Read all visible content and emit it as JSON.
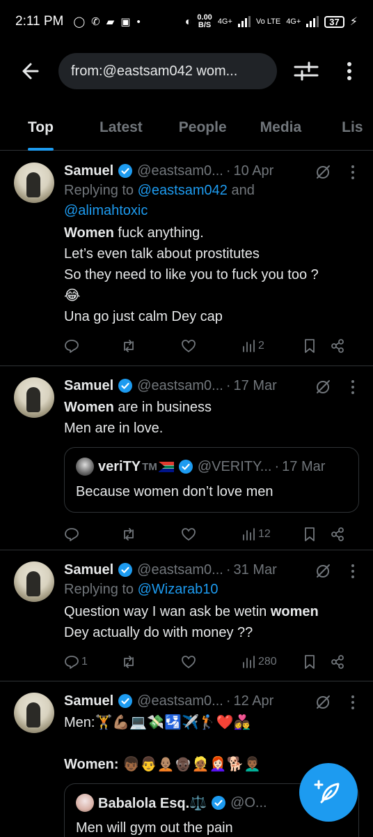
{
  "status_bar": {
    "time": "2:11 PM",
    "net_speed_value": "0.00",
    "net_speed_unit": "B/S",
    "net1": "4G+",
    "net2": "Vo LTE",
    "net3": "4G+",
    "battery": "37"
  },
  "search": {
    "query": "from:@eastsam042 wom..."
  },
  "tabs": [
    {
      "label": "Top",
      "active": true
    },
    {
      "label": "Latest",
      "active": false
    },
    {
      "label": "People",
      "active": false
    },
    {
      "label": "Media",
      "active": false
    },
    {
      "label": "Lis",
      "active": false
    }
  ],
  "tweets": [
    {
      "name": "Samuel",
      "handle": "@eastsam0...",
      "date": "10 Apr",
      "reply_prefix": "Replying to ",
      "reply_user1": "@eastsam042",
      "reply_and": " and",
      "reply_user2": "@alimahtoxic",
      "line1_bold": "Women",
      "line1_rest": " fuck anything.",
      "line2": "Let’s even talk about prostitutes",
      "line3": "So they need to like you to fuck you too ?",
      "line4": "😂",
      "line5": "Una go just calm Dey cap",
      "views": "2"
    },
    {
      "name": "Samuel",
      "handle": "@eastsam0...",
      "date": "17 Mar",
      "line1_bold": "Women",
      "line1_rest": " are in business",
      "line2": "Men are in love.",
      "quote": {
        "name": "veriTY",
        "tm": "TM",
        "handle": "@VERITY...",
        "date": "17 Mar",
        "text": "Because women don’t love men"
      },
      "views": "12"
    },
    {
      "name": "Samuel",
      "handle": "@eastsam0...",
      "date": "31 Mar",
      "reply_prefix": "Replying to ",
      "reply_user1": "@Wizarab10",
      "line1": "Question way I wan ask be wetin ",
      "line1_bold": "women",
      "line2": "Dey actually do with money ??",
      "replies": "1",
      "views": "280"
    },
    {
      "name": "Samuel",
      "handle": "@eastsam0...",
      "date": "12 Apr",
      "line1": "Men:🏋️💪🏽💻💸🛂✈️🏌️❤️👩‍❤️‍👨",
      "line2_bold": "Women:",
      "line2_rest": " 👦🏾👨🧑🏽‍🦲👴🏿👱🏾👩🏻‍🦰🐕👨🏾‍🦱",
      "quote": {
        "name": "Babalola Esq.⚖️",
        "handle": "@O...",
        "text": "Men will gym out the pain"
      }
    }
  ],
  "icons": {
    "back": "arrow-left-icon",
    "filter": "sliders-icon",
    "more": "vertical-dots-icon",
    "grok": "grok-slash-icon",
    "reply": "reply-icon",
    "retweet": "retweet-icon",
    "like": "heart-icon",
    "views": "bar-chart-icon",
    "bookmark": "bookmark-icon",
    "share": "share-icon",
    "compose": "feather-plus-icon"
  },
  "colors": {
    "accent": "#1d9bf0",
    "background": "#000000",
    "text": "#e7e9ea",
    "muted": "#71767b",
    "border": "#2f3336"
  }
}
